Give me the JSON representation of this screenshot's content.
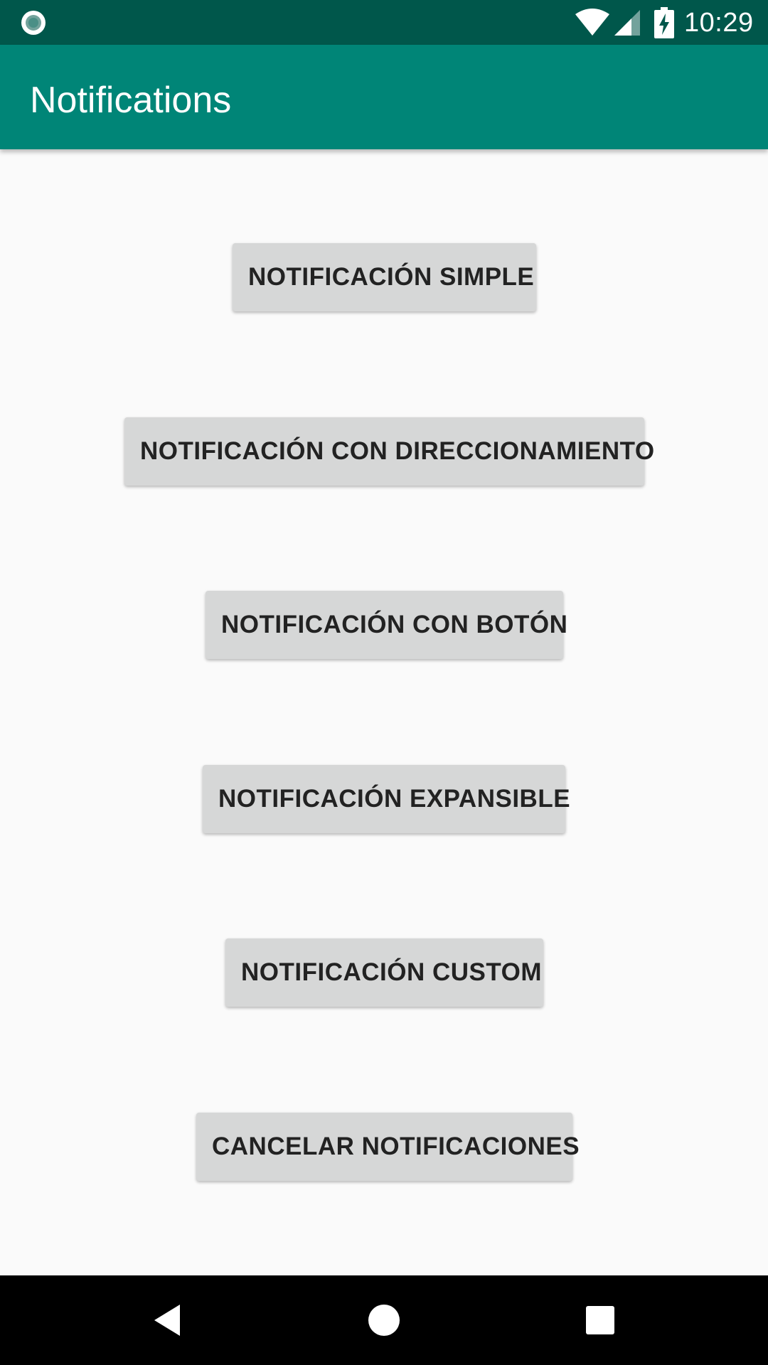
{
  "status_bar": {
    "time": "10:29",
    "icons": [
      "notification-dot-icon",
      "wifi-icon",
      "signal-icon",
      "battery-charging-icon"
    ]
  },
  "app_bar": {
    "title": "Notifications"
  },
  "buttons": [
    {
      "label": "NOTIFICACIÓN SIMPLE"
    },
    {
      "label": "NOTIFICACIÓN CON DIRECCIONAMIENTO"
    },
    {
      "label": "NOTIFICACIÓN CON BOTÓN"
    },
    {
      "label": "NOTIFICACIÓN EXPANSIBLE"
    },
    {
      "label": "NOTIFICACIÓN CUSTOM"
    },
    {
      "label": "CANCELAR NOTIFICACIONES"
    }
  ],
  "nav_bar": {
    "icons": [
      "back-icon",
      "home-icon",
      "recents-icon"
    ]
  },
  "colors": {
    "status_bar": "#00574b",
    "app_bar": "#008577",
    "background": "#fafafa",
    "button": "#d6d7d7",
    "button_text": "#222222"
  }
}
